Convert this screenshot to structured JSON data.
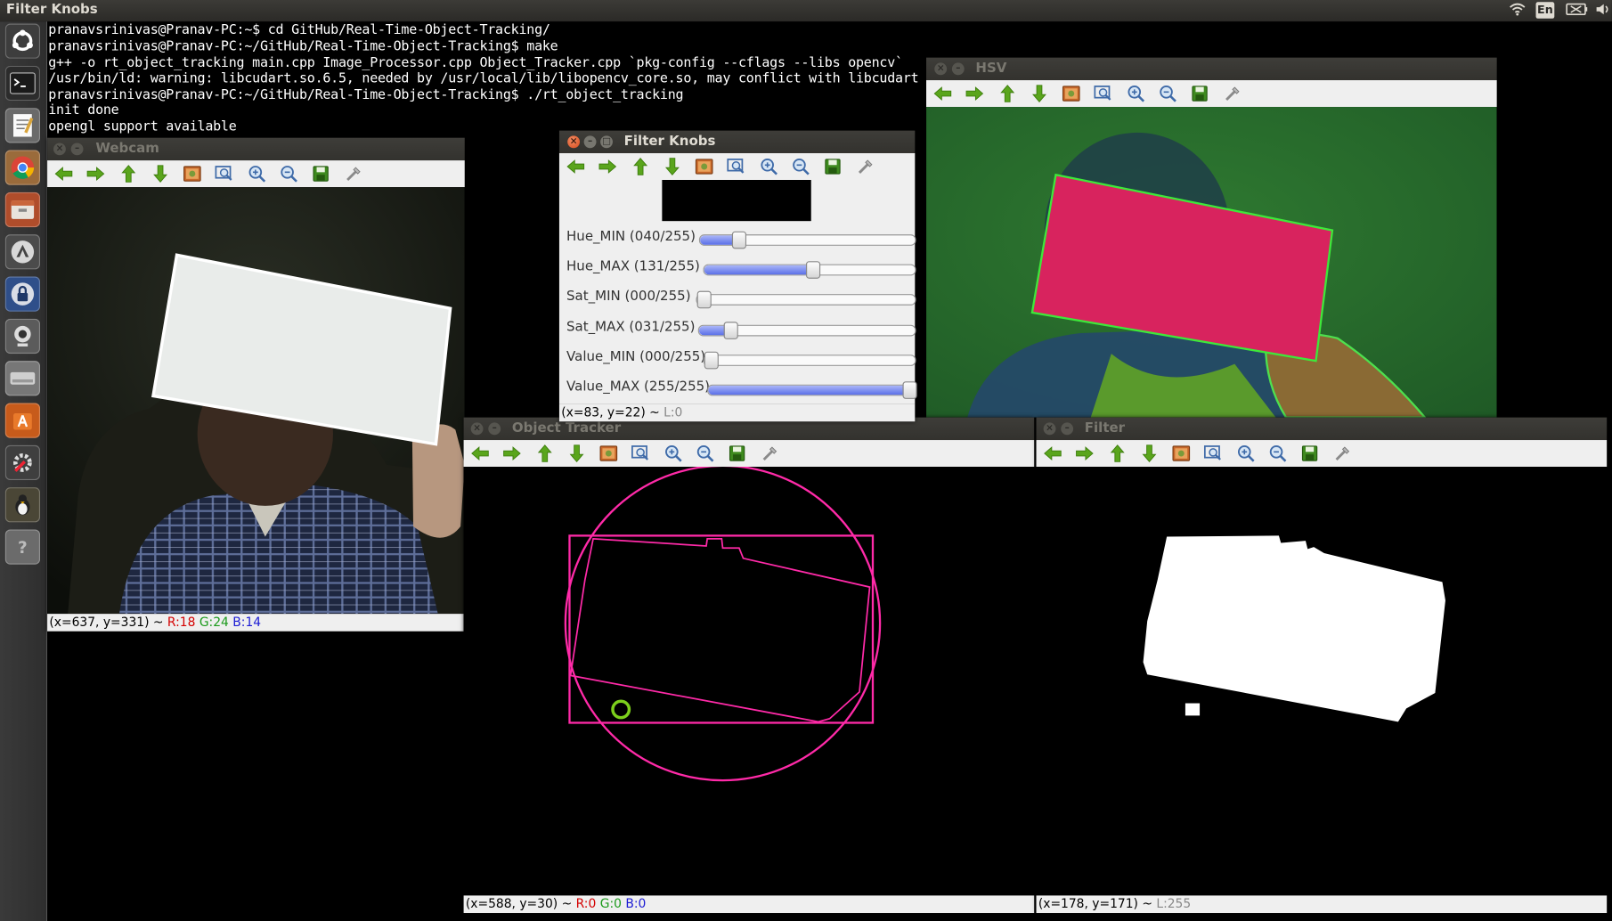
{
  "top_panel": {
    "window_title": "Filter Knobs",
    "language_indicator": "En"
  },
  "terminal": {
    "lines": [
      "pranavsrinivas@Pranav-PC:~$ cd GitHub/Real-Time-Object-Tracking/",
      "pranavsrinivas@Pranav-PC:~/GitHub/Real-Time-Object-Tracking$ make",
      "g++ -o rt_object_tracking main.cpp Image_Processor.cpp Object_Tracker.cpp `pkg-config --cflags --libs opencv`",
      "/usr/bin/ld: warning: libcudart.so.6.5, needed by /usr/local/lib/libopencv_core.so, may conflict with libcudart",
      "pranavsrinivas@Pranav-PC:~/GitHub/Real-Time-Object-Tracking$ ./rt_object_tracking",
      "init done",
      "opengl support available"
    ]
  },
  "windows": {
    "webcam": {
      "title": "Webcam",
      "status_coords": "(x=637, y=331) ~ ",
      "r": "R:18",
      "g": "G:24",
      "b": "B:14"
    },
    "hsv": {
      "title": "HSV"
    },
    "filter_knobs": {
      "title": "Filter Knobs",
      "status": "(x=83, y=22) ~ ",
      "status_level": "L:0",
      "knobs": [
        {
          "label": "Hue_MIN",
          "value_text": "(040/255)",
          "value": 40,
          "max": 255
        },
        {
          "label": "Hue_MAX",
          "value_text": "(131/255)",
          "value": 131,
          "max": 255
        },
        {
          "label": "Sat_MIN",
          "value_text": "(000/255)",
          "value": 0,
          "max": 255
        },
        {
          "label": "Sat_MAX",
          "value_text": "(031/255)",
          "value": 31,
          "max": 255
        },
        {
          "label": "Value_MIN",
          "value_text": "(000/255)",
          "value": 0,
          "max": 255
        },
        {
          "label": "Value_MAX",
          "value_text": "(255/255)",
          "value": 255,
          "max": 255
        }
      ]
    },
    "object_tracker": {
      "title": "Object Tracker",
      "status_coords": "(x=588, y=30) ~ ",
      "r": "R:0",
      "g": "G:0",
      "b": "B:0"
    },
    "filter": {
      "title": "Filter",
      "status_coords": "(x=178, y=171) ~ ",
      "status_level": "L:255"
    }
  },
  "toolbar_icons": [
    "pan-left-icon",
    "pan-right-icon",
    "pan-up-icon",
    "pan-down-icon",
    "reset-view-icon",
    "zoom-fit-icon",
    "zoom-in-icon",
    "zoom-out-icon",
    "save-icon",
    "properties-icon"
  ],
  "colors": {
    "terminal_bg": "#000000",
    "tracker_magenta": "#ff2aa8",
    "tracker_green": "#7ccf1c",
    "slider_fill": "#5a6fe8",
    "status_red": "#d40000",
    "status_green": "#1c9a1c",
    "status_blue": "#1c1cd4"
  }
}
